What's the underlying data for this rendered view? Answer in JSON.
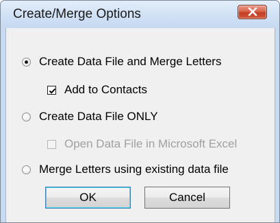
{
  "window": {
    "title": "Create/Merge Options",
    "close_icon": "close-x-icon"
  },
  "options": {
    "create_and_merge": {
      "label": "Create Data File and Merge Letters",
      "selected": true
    },
    "add_to_contacts": {
      "label": "Add to Contacts",
      "checked": true,
      "enabled": true
    },
    "create_only": {
      "label": "Create Data File ONLY",
      "selected": false
    },
    "open_in_excel": {
      "label": "Open Data File in Microsoft Excel",
      "checked": false,
      "enabled": false
    },
    "merge_existing": {
      "label": "Merge Letters using existing data file",
      "selected": false
    }
  },
  "buttons": {
    "ok_label": "OK",
    "cancel_label": "Cancel"
  },
  "colors": {
    "titlebar": "#d3e3f6",
    "close_button": "#c8472d",
    "dialog_bg": "#f0f0f0",
    "disabled_text": "#a0a0a0"
  }
}
